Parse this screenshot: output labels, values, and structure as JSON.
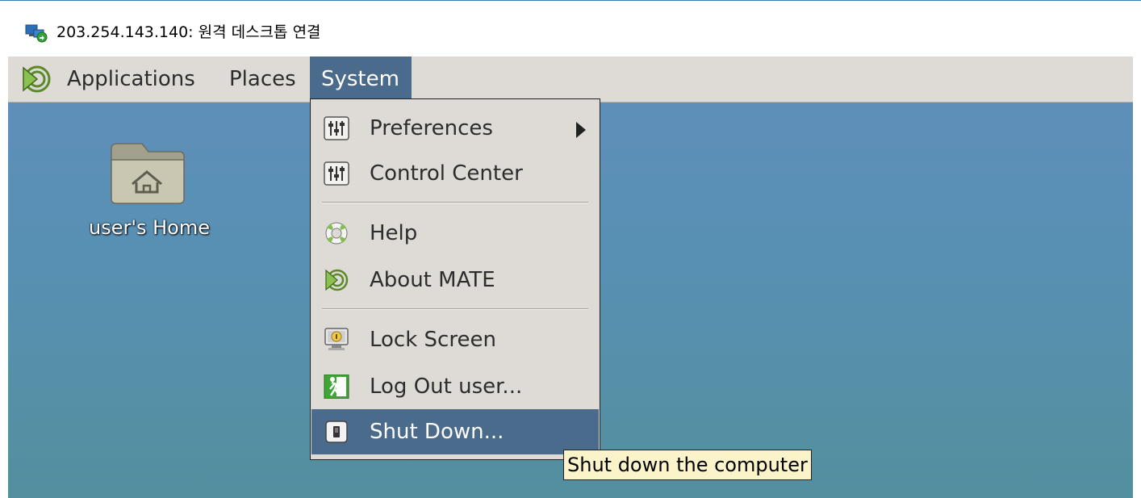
{
  "window": {
    "title": "203.254.143.140: 원격 데스크톱 연결",
    "title_icon": "remote-desktop-icon"
  },
  "panel": {
    "applications_label": "Applications",
    "places_label": "Places",
    "system_label": "System",
    "logo_icon": "mate-logo-icon"
  },
  "desktop": {
    "home_label": "user's Home",
    "home_icon": "home-folder-icon"
  },
  "system_menu": {
    "items": [
      {
        "label": "Preferences",
        "icon": "preferences-icon",
        "has_submenu": true
      },
      {
        "label": "Control Center",
        "icon": "control-center-icon"
      },
      {
        "label": "Help",
        "icon": "help-lifebuoy-icon"
      },
      {
        "label": "About MATE",
        "icon": "mate-logo-icon"
      },
      {
        "label": "Lock Screen",
        "icon": "lock-screen-icon"
      },
      {
        "label": "Log Out user...",
        "icon": "log-out-icon"
      },
      {
        "label": "Shut Down...",
        "icon": "shut-down-icon",
        "highlighted": true
      }
    ]
  },
  "tooltip": {
    "text": "Shut down the computer"
  },
  "colors": {
    "panel_bg": "#dedbd6",
    "highlight": "#4b6b8c",
    "tooltip_bg": "#fbf3c9"
  }
}
